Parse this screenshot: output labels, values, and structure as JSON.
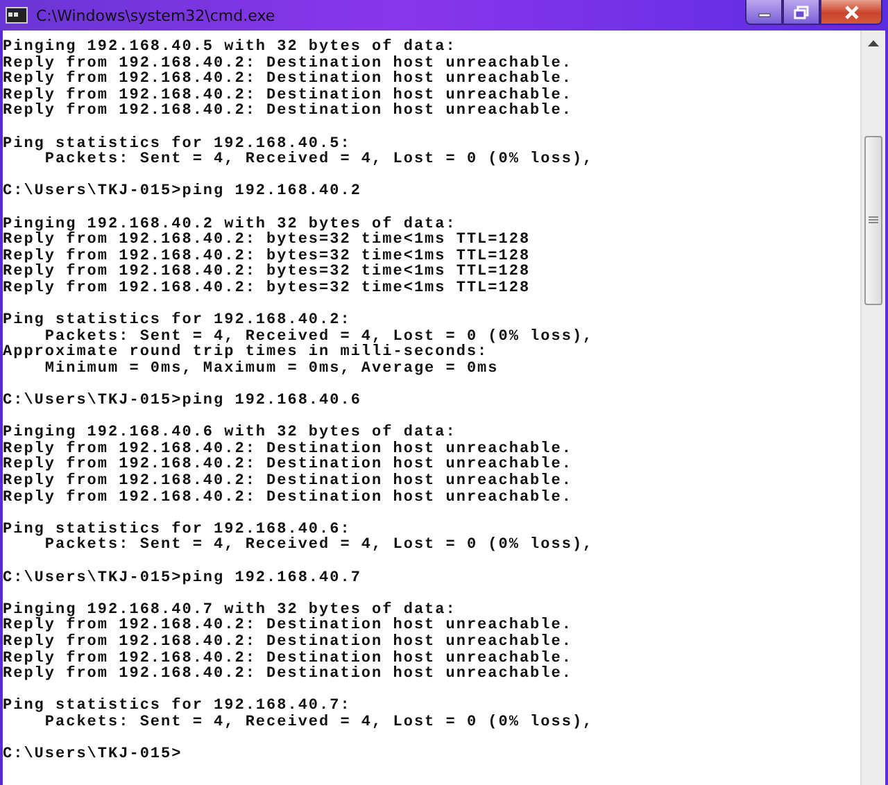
{
  "window": {
    "title": "C:\\Windows\\system32\\cmd.exe"
  },
  "lines": [
    {
      "kind": "text",
      "text": "Pinging 192.168.40.5 with 32 bytes of data:"
    },
    {
      "kind": "text",
      "text": "Reply from 192.168.40.2: Destination host unreachable."
    },
    {
      "kind": "text",
      "text": "Reply from 192.168.40.2: Destination host unreachable."
    },
    {
      "kind": "text",
      "text": "Reply from 192.168.40.2: Destination host unreachable."
    },
    {
      "kind": "text",
      "text": "Reply from 192.168.40.2: Destination host unreachable."
    },
    {
      "kind": "blank"
    },
    {
      "kind": "text",
      "text": "Ping statistics for 192.168.40.5:"
    },
    {
      "kind": "text",
      "text": "    Packets: Sent = 4, Received = 4, Lost = 0 (0% loss),"
    },
    {
      "kind": "blank"
    },
    {
      "kind": "text",
      "text": "C:\\Users\\TKJ-015>ping 192.168.40.2"
    },
    {
      "kind": "blank"
    },
    {
      "kind": "text",
      "text": "Pinging 192.168.40.2 with 32 bytes of data:"
    },
    {
      "kind": "text",
      "text": "Reply from 192.168.40.2: bytes=32 time<1ms TTL=128"
    },
    {
      "kind": "text",
      "text": "Reply from 192.168.40.2: bytes=32 time<1ms TTL=128"
    },
    {
      "kind": "text",
      "text": "Reply from 192.168.40.2: bytes=32 time<1ms TTL=128"
    },
    {
      "kind": "text",
      "text": "Reply from 192.168.40.2: bytes=32 time<1ms TTL=128"
    },
    {
      "kind": "blank"
    },
    {
      "kind": "text",
      "text": "Ping statistics for 192.168.40.2:"
    },
    {
      "kind": "text",
      "text": "    Packets: Sent = 4, Received = 4, Lost = 0 (0% loss),"
    },
    {
      "kind": "text",
      "text": "Approximate round trip times in milli-seconds:"
    },
    {
      "kind": "text",
      "text": "    Minimum = 0ms, Maximum = 0ms, Average = 0ms"
    },
    {
      "kind": "blank"
    },
    {
      "kind": "text",
      "text": "C:\\Users\\TKJ-015>ping 192.168.40.6"
    },
    {
      "kind": "blank"
    },
    {
      "kind": "text",
      "text": "Pinging 192.168.40.6 with 32 bytes of data:"
    },
    {
      "kind": "text",
      "text": "Reply from 192.168.40.2: Destination host unreachable."
    },
    {
      "kind": "text",
      "text": "Reply from 192.168.40.2: Destination host unreachable."
    },
    {
      "kind": "text",
      "text": "Reply from 192.168.40.2: Destination host unreachable."
    },
    {
      "kind": "text",
      "text": "Reply from 192.168.40.2: Destination host unreachable."
    },
    {
      "kind": "blank"
    },
    {
      "kind": "text",
      "text": "Ping statistics for 192.168.40.6:"
    },
    {
      "kind": "text",
      "text": "    Packets: Sent = 4, Received = 4, Lost = 0 (0% loss),"
    },
    {
      "kind": "blank"
    },
    {
      "kind": "text",
      "text": "C:\\Users\\TKJ-015>ping 192.168.40.7"
    },
    {
      "kind": "blank"
    },
    {
      "kind": "text",
      "text": "Pinging 192.168.40.7 with 32 bytes of data:"
    },
    {
      "kind": "text",
      "text": "Reply from 192.168.40.2: Destination host unreachable."
    },
    {
      "kind": "text",
      "text": "Reply from 192.168.40.2: Destination host unreachable."
    },
    {
      "kind": "text",
      "text": "Reply from 192.168.40.2: Destination host unreachable."
    },
    {
      "kind": "text",
      "text": "Reply from 192.168.40.2: Destination host unreachable."
    },
    {
      "kind": "blank"
    },
    {
      "kind": "text",
      "text": "Ping statistics for 192.168.40.7:"
    },
    {
      "kind": "text",
      "text": "    Packets: Sent = 4, Received = 4, Lost = 0 (0% loss),"
    },
    {
      "kind": "blank"
    },
    {
      "kind": "text",
      "text": "C:\\Users\\TKJ-015>"
    }
  ]
}
